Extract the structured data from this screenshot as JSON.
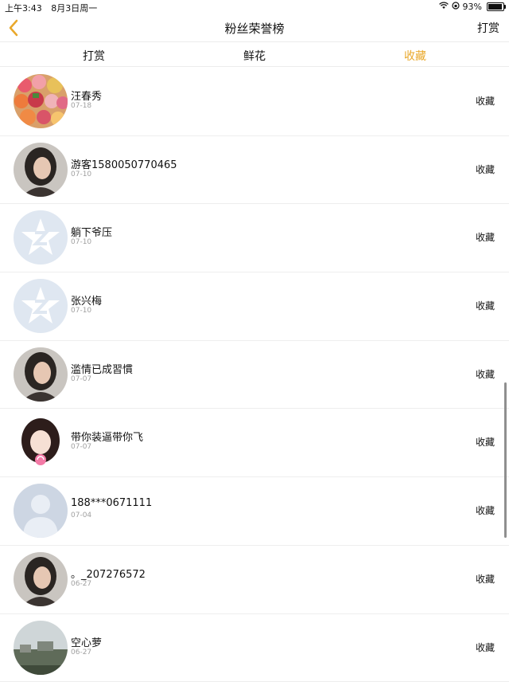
{
  "status": {
    "time": "上午3:43",
    "date": "8月3日周一",
    "battery": "93%",
    "battery_level": 0.93
  },
  "nav": {
    "title": "粉丝荣誉榜",
    "right_label": "打赏"
  },
  "tabs": [
    {
      "label": "打赏",
      "active": false
    },
    {
      "label": "鲜花",
      "active": false
    },
    {
      "label": "收藏",
      "active": true
    }
  ],
  "colors": {
    "accent": "#e9a82b",
    "divider": "#eeeeee",
    "muted": "#a0a0a0"
  },
  "fans": [
    {
      "name": "汪春秀",
      "date": "07-18",
      "action": "收藏",
      "avatar": "fruit-photo"
    },
    {
      "name": "游客1580050770465",
      "date": "07-10",
      "action": "收藏",
      "avatar": "portrait-photo"
    },
    {
      "name": "躺下爷压",
      "date": "07-10",
      "action": "收藏",
      "avatar": "default-qq-avatar"
    },
    {
      "name": "张兴梅",
      "date": "07-10",
      "action": "收藏",
      "avatar": "default-qq-avatar"
    },
    {
      "name": "滥情已成習慣",
      "date": "07-07",
      "action": "收藏",
      "avatar": "portrait-photo"
    },
    {
      "name": "带你装逼带你飞",
      "date": "07-07",
      "action": "收藏",
      "avatar": "cartoon-girl"
    },
    {
      "name": "188***0671111",
      "date": "07-04",
      "action": "收藏",
      "avatar": "default-person-avatar"
    },
    {
      "name": "。_207276572",
      "date": "06-27",
      "action": "收藏",
      "avatar": "portrait-photo"
    },
    {
      "name": "空心萝",
      "date": "06-27",
      "action": "收藏",
      "avatar": "landscape-photo"
    }
  ]
}
